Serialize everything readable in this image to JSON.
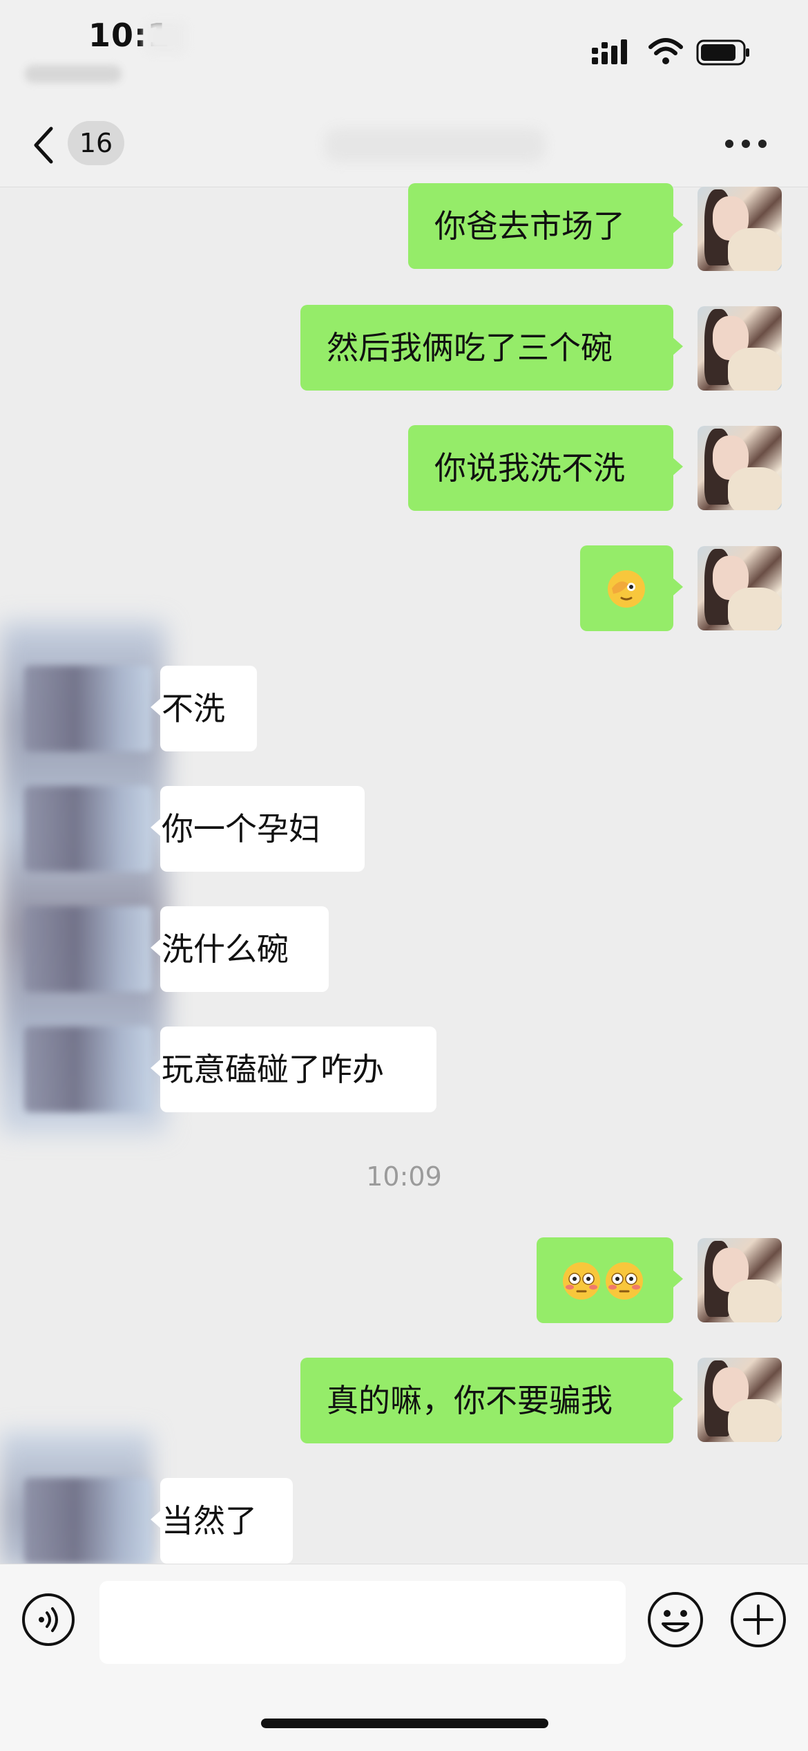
{
  "status_bar": {
    "time": "10:1",
    "signal_icon": "cellular-signal-icon",
    "wifi_icon": "wifi-icon",
    "battery_icon": "battery-icon"
  },
  "header": {
    "unread_count": "16",
    "back_icon": "chevron-left-icon",
    "more_icon": "more-dots-icon"
  },
  "colors": {
    "sent_bubble": "#95ec69",
    "received_bubble": "#ffffff",
    "background": "#ededed"
  },
  "messages": [
    {
      "side": "right",
      "text": "你爸去市场了"
    },
    {
      "side": "right",
      "text": "然后我俩吃了三个碗"
    },
    {
      "side": "right",
      "text": "你说我洗不洗"
    },
    {
      "side": "right",
      "emoji": "face-with-hand-over-eye-emoji"
    },
    {
      "side": "left",
      "text": "不洗"
    },
    {
      "side": "left",
      "text": "你一个孕妇"
    },
    {
      "side": "left",
      "text": "洗什么碗"
    },
    {
      "side": "left",
      "text": "玩意磕碰了咋办"
    },
    {
      "timestamp": "10:09"
    },
    {
      "side": "right",
      "emoji": "flushed-face-emoji x2"
    },
    {
      "side": "right",
      "text": "真的嘛，你不要骗我"
    },
    {
      "side": "left",
      "text": "当然了"
    }
  ],
  "input_bar": {
    "voice_icon": "voice-input-icon",
    "text_value": "",
    "emoji_icon": "emoji-smile-icon",
    "plus_icon": "plus-circle-icon"
  }
}
